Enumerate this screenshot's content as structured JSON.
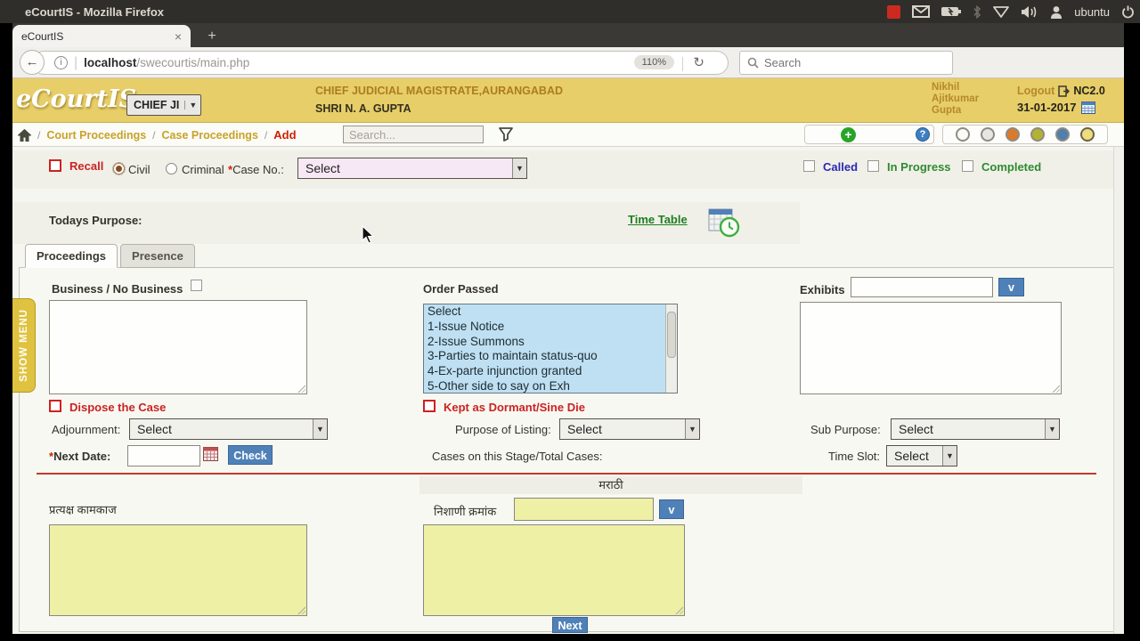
{
  "system": {
    "window_title": "eCourtIS - Mozilla Firefox",
    "user": "ubuntu"
  },
  "browser": {
    "tab_title": "eCourtIS",
    "close_tab": "×",
    "new_tab": "+",
    "back": "←",
    "url_host": "localhost",
    "url_path": "/swecourtis/main.php",
    "zoom_level": "110%",
    "reload": "↻",
    "search_placeholder": "Search",
    "menu": "≡",
    "star": "☆",
    "home": "⌂",
    "download": "↓"
  },
  "header": {
    "logo": "eCourtIS",
    "court_select": "CHIEF JI",
    "court_select_arrow": "▼",
    "court_name": "CHIEF JUDICIAL MAGISTRATE,AURANGABAD",
    "judge_name": "SHRI N. A. GUPTA",
    "user_name": "Nikhil Ajitkumar Gupta",
    "logout_label": "Logout",
    "version": "NC2.0",
    "date": "31-01-2017"
  },
  "breadcrumb": {
    "separator": "/",
    "link1": "Court Proceedings",
    "link2": "Case Proceedings",
    "current": "Add",
    "search_placeholder": "Search...",
    "add_plus": "+",
    "help_mark": "?"
  },
  "theme_circles": [
    {
      "fill": "#fafaf6"
    },
    {
      "fill": "#e6e6e2"
    },
    {
      "fill": "#dd7a28"
    },
    {
      "fill": "#b3b232"
    },
    {
      "fill": "#4f7fae"
    },
    {
      "fill": "#eddd7e"
    }
  ],
  "recall_row": {
    "recall": "Recall",
    "civil": "Civil",
    "criminal": "Criminal",
    "required_mark": "*",
    "case_no_label": "Case No.:",
    "case_no_value": "Select",
    "called": "Called",
    "in_progress": "In Progress",
    "completed": "Completed"
  },
  "purpose_row": {
    "todays_purpose": "Todays Purpose:",
    "time_table": "Time Table"
  },
  "tabs": {
    "proceedings": "Proceedings",
    "presence": "Presence"
  },
  "proceedings_form": {
    "business_label": "Business / No Business",
    "order_passed_label": "Order Passed",
    "order_options": [
      "Select",
      "1-Issue Notice",
      "2-Issue Summons",
      "3-Parties to maintain status-quo",
      "4-Ex-parte injunction granted",
      "5-Other side to say on Exh"
    ],
    "exhibits_label": "Exhibits",
    "exhibits_value": "",
    "v_button": "v",
    "dispose_label": "Dispose the Case",
    "dormant_label": "Kept as Dormant/Sine Die",
    "adjournment_label": "Adjournment:",
    "adjournment_value": "Select",
    "purpose_of_listing_label": "Purpose of Listing:",
    "purpose_of_listing_value": "Select",
    "sub_purpose_label": "Sub Purpose:",
    "sub_purpose_value": "Select",
    "required_mark": "*",
    "next_date_label": "Next Date:",
    "next_date_value": "",
    "check_button": "Check",
    "cases_stage_label": "Cases on this Stage/Total Cases:",
    "time_slot_label": "Time Slot:",
    "time_slot_value": "Select",
    "marathi_heading": "मराठी",
    "marathi_work_label": "प्रत्यक्ष कामकाज",
    "marathi_exhibit_label": "निशाणी क्रमांक",
    "marathi_exhibit_value": "",
    "next_button": "Next"
  },
  "show_menu_label": "SHOW MENU"
}
